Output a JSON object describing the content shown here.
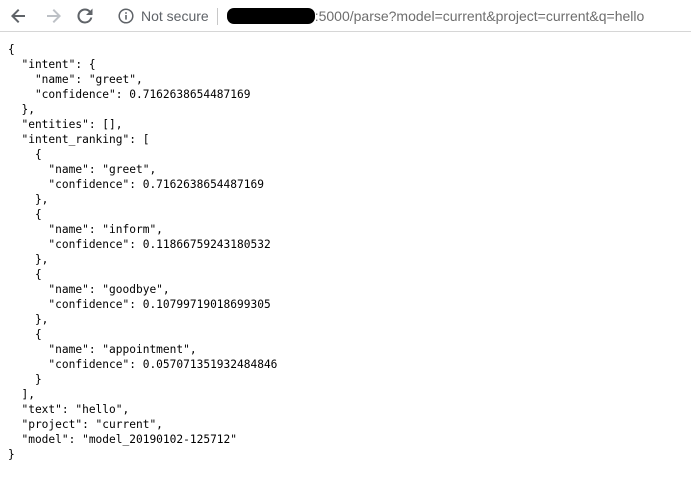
{
  "browser": {
    "security_label": "Not secure",
    "url_visible": ":5000/parse?model=current&project=current&q=hello",
    "icons": {
      "back": "arrow-left-icon",
      "forward": "arrow-right-icon",
      "reload": "reload-icon",
      "info": "info-circle-icon"
    }
  },
  "page": {
    "json_text": "{\n  \"intent\": {\n    \"name\": \"greet\",\n    \"confidence\": 0.7162638654487169\n  },\n  \"entities\": [],\n  \"intent_ranking\": [\n    {\n      \"name\": \"greet\",\n      \"confidence\": 0.7162638654487169\n    },\n    {\n      \"name\": \"inform\",\n      \"confidence\": 0.11866759243180532\n    },\n    {\n      \"name\": \"goodbye\",\n      \"confidence\": 0.10799719018699305\n    },\n    {\n      \"name\": \"appointment\",\n      \"confidence\": 0.057071351932484846\n    }\n  ],\n  \"text\": \"hello\",\n  \"project\": \"current\",\n  \"model\": \"model_20190102-125712\"\n}"
  }
}
